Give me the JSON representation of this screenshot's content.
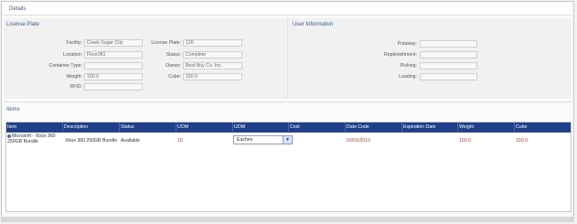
{
  "details_title": "Details",
  "license_plate": {
    "title": "License Plate",
    "left_fields": [
      {
        "label": "Facility:",
        "value": "Creek Sugar City"
      },
      {
        "label": "Location:",
        "value": "Floor381"
      },
      {
        "label": "Container Type:",
        "value": ""
      },
      {
        "label": "Weight:",
        "value": "150.0"
      },
      {
        "label": "RFID:",
        "value": ""
      }
    ],
    "right_fields": [
      {
        "label": "License Plate:",
        "value": "120"
      },
      {
        "label": "Status:",
        "value": "Complete"
      },
      {
        "label": "Owner:",
        "value": "Best Buy Co. Inc."
      },
      {
        "label": "Cube:",
        "value": "150.0"
      }
    ]
  },
  "user_information": {
    "title": "User Information",
    "fields": [
      {
        "label": "Putaway:",
        "value": ""
      },
      {
        "label": "Replenishment:",
        "value": ""
      },
      {
        "label": "Picking:",
        "value": ""
      },
      {
        "label": "Loading:",
        "value": ""
      }
    ]
  },
  "items": {
    "title": "Items",
    "columns": [
      "Item",
      "Description",
      "Status",
      "UOM",
      "UOM",
      "Cost",
      "Date Code",
      "Expiration Date",
      "Weight",
      "Cube"
    ],
    "rows": [
      {
        "item_line1": "Microsoft - Xbox 360",
        "item_line2": "250GB Bundle",
        "description": "Xbox 360 250GB Bundle",
        "status": "Available",
        "uom_qty": "15",
        "uom_select": "Eaches",
        "cost": "",
        "date_code": "03/01/2013",
        "expiration_date": "",
        "weight": "150.0",
        "cube": "150.0"
      }
    ]
  },
  "colors": {
    "header_bg": "#1f3f8a",
    "section_title": "#3a5d8c",
    "row_text_red": "#c0392b"
  }
}
